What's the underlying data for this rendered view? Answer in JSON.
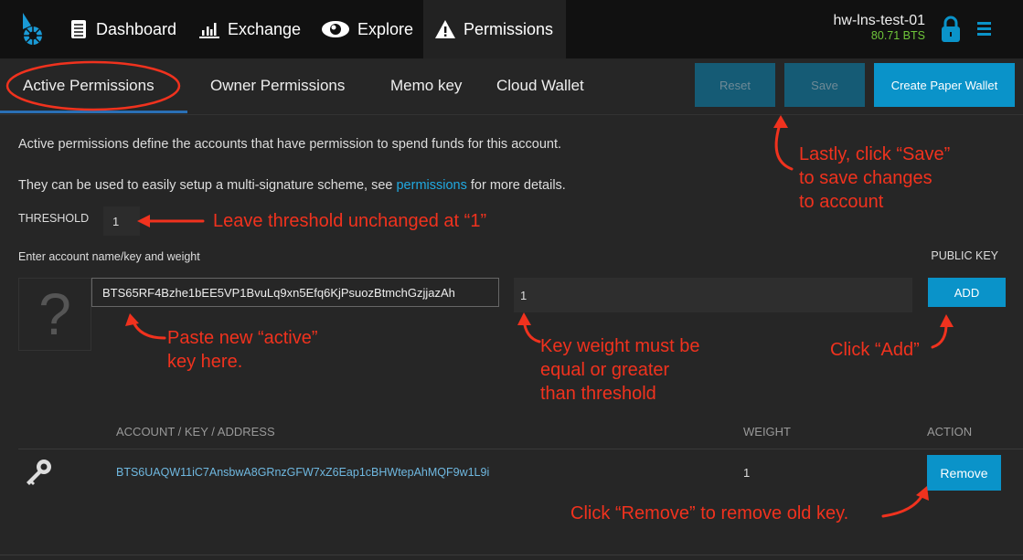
{
  "nav": {
    "items": [
      {
        "label": "Dashboard",
        "icon": "dashboard-icon"
      },
      {
        "label": "Exchange",
        "icon": "chart-icon"
      },
      {
        "label": "Explore",
        "icon": "eye-icon"
      },
      {
        "label": "Permissions",
        "icon": "warning-icon"
      }
    ],
    "account": "hw-lns-test-01",
    "balance": "80.71 BTS"
  },
  "tabs": [
    "Active Permissions",
    "Owner Permissions",
    "Memo key",
    "Cloud Wallet"
  ],
  "actions": {
    "reset": "Reset",
    "save": "Save",
    "paper_wallet": "Create Paper Wallet"
  },
  "content": {
    "desc1": "Active permissions define the accounts that have permission to spend funds for this account.",
    "desc2_pre": "They can be used to easily setup a multi-signature scheme, see ",
    "desc2_link": "permissions",
    "desc2_post": " for more details.",
    "threshold_label": "THRESHOLD",
    "threshold_value": "1",
    "enter_label": "Enter account name/key and weight",
    "public_key_label": "PUBLIC KEY",
    "key_input": "BTS65RF4Bzhe1bEE5VP1BvuLq9xn5Efq6KjPsuozBtmchGzjjazAh",
    "weight_input": "1",
    "add": "ADD",
    "avatar_placeholder": "?"
  },
  "table": {
    "headers": [
      "ACCOUNT / KEY / ADDRESS",
      "WEIGHT",
      "ACTION"
    ],
    "rows": [
      {
        "key": "BTS6UAQW11iC7AnsbwA8GRnzGFW7xZ6Eap1cBHWtepAhMQF9w1L9i",
        "weight": "1",
        "action": "Remove"
      }
    ]
  },
  "annotations": {
    "save": [
      "Lastly, click “Save”",
      "to save changes",
      "to account"
    ],
    "threshold": "Leave threshold unchanged at “1”",
    "paste": [
      "Paste new “active”",
      "key here."
    ],
    "weight": [
      "Key weight must be",
      "equal or greater",
      "than threshold"
    ],
    "add": "Click “Add”",
    "remove": "Click “Remove” to remove old key."
  },
  "colors": {
    "accent": "#0a93c9",
    "annotation": "#f0321e",
    "balance": "#6fc63a",
    "link": "#21a9e1"
  }
}
